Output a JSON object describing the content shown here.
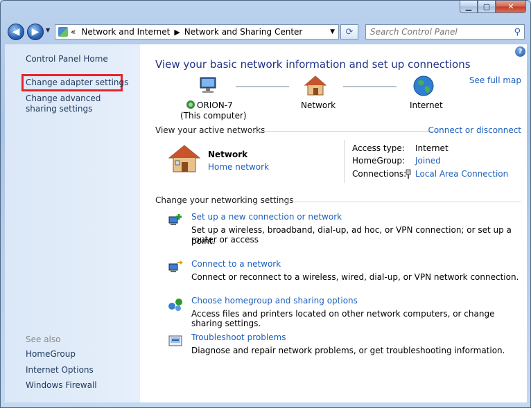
{
  "window": {
    "buttons": {
      "minimize": "▁",
      "maximize": "▢",
      "close": "✕"
    }
  },
  "navigation": {
    "back_glyph": "◀",
    "forward_glyph": "▶",
    "breadcrumb": [
      "Network and Internet",
      "Network and Sharing Center"
    ],
    "breadcrumb_prefix": "«",
    "search_placeholder": "Search Control Panel"
  },
  "sidebar": {
    "items": [
      "Control Panel Home",
      "Change adapter settings",
      "Change advanced sharing settings"
    ],
    "highlighted_item": "Change adapter settings",
    "see_also_heading": "See also",
    "see_also": [
      "HomeGroup",
      "Internet Options",
      "Windows Firewall"
    ]
  },
  "main": {
    "title": "View your basic network information and set up connections",
    "see_full_map": "See full map",
    "map": {
      "computer_name": "ORION-7",
      "computer_note": "(This computer)",
      "network_label": "Network",
      "internet_label": "Internet"
    },
    "active_networks": {
      "heading": "View your active networks",
      "action": "Connect or disconnect",
      "network_name": "Network",
      "network_type": "Home network",
      "access_type_label": "Access type:",
      "access_type_value": "Internet",
      "homegroup_label": "HomeGroup:",
      "homegroup_value": "Joined",
      "connections_label": "Connections:",
      "connections_value": "Local Area Connection"
    },
    "settings": {
      "heading": "Change your networking settings",
      "tasks": [
        {
          "title": "Set up a new connection or network",
          "desc_line1": "Set up a wireless, broadband, dial-up, ad hoc, or VPN connection; or set up a router or access",
          "desc_line2": "point."
        },
        {
          "title": "Connect to a network",
          "desc_line1": "Connect or reconnect to a wireless, wired, dial-up, or VPN network connection.",
          "desc_line2": ""
        },
        {
          "title": "Choose homegroup and sharing options",
          "desc_line1": "Access files and printers located on other network computers, or change sharing settings.",
          "desc_line2": ""
        },
        {
          "title": "Troubleshoot problems",
          "desc_line1": "Diagnose and repair network problems, or get troubleshooting information.",
          "desc_line2": ""
        }
      ]
    }
  },
  "colors": {
    "link": "#1c5fbd",
    "title": "#1e3287",
    "highlight_border": "#e5232a",
    "sidebar_text": "#1e395b"
  }
}
